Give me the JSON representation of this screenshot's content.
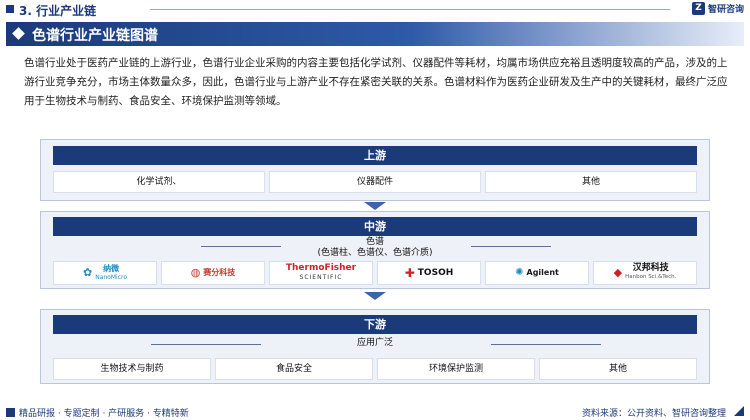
{
  "header": {
    "section_title": "3. 行业产业链",
    "brand_name": "智研咨询",
    "brand_logo_char": "Z"
  },
  "banner": {
    "title": "色谱行业产业链图谱"
  },
  "intro": {
    "text": "色谱行业处于医药产业链的上游行业，色谱行业企业采购的内容主要包括化学试剂、仪器配件等耗材，均属市场供应充裕且透明度较高的产品，涉及的上游行业竞争充分，市场主体数量众多，因此，色谱行业与上游产业不存在紧密关联的关系。色谱材料作为医药企业研发及生产中的关键耗材，最终广泛应用于生物技术与制药、食品安全、环境保护监测等领域。"
  },
  "upstream": {
    "title": "上游",
    "items": [
      "化学试剂、",
      "仪器配件",
      "其他"
    ]
  },
  "midstream": {
    "title": "中游",
    "label_line1": "色谱",
    "label_line2": "(色谱柱、色谱仪、色谱介质)",
    "logos": [
      {
        "text": "纳微",
        "sub": "NanoMicro",
        "color": "#1e8bc3"
      },
      {
        "text": "赛分科技",
        "sub": "",
        "color": "#c0392b"
      },
      {
        "text": "ThermoFisher",
        "sub": "SCIENTIFIC",
        "color": "#d32027"
      },
      {
        "text": "TOSOH",
        "sub": "",
        "color": "#111111"
      },
      {
        "text": "Agilent",
        "sub": "",
        "color": "#1a1a1a"
      },
      {
        "text": "汉邦科技",
        "sub": "Hanbon Sci.&Tech.",
        "color": "#111111"
      }
    ]
  },
  "downstream": {
    "title": "下游",
    "label": "应用广泛",
    "items": [
      "生物技术与制药",
      "食品安全",
      "环境保护监测",
      "其他"
    ]
  },
  "footer": {
    "left": "精品研报 · 专题定制 · 产研服务 · 专精特新",
    "source": "资料来源：公开资料、智研咨询整理"
  },
  "colors": {
    "primary": "#1b3a7a",
    "panel_bg": "#eef2f8",
    "arrow": "#3f63a8"
  }
}
